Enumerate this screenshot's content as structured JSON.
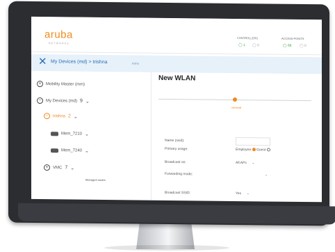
{
  "header": {
    "logo": "aruba",
    "logo_sub": "NETWORKS",
    "controllers": {
      "label": "CONTROLLERS",
      "up": "1",
      "down": "0"
    },
    "access_points": {
      "label": "ACCESS POINTS",
      "up": "66",
      "down": "0"
    }
  },
  "breadcrumb": {
    "path": "My Devices (md) > trishna",
    "tag": "trisha"
  },
  "sidebar": {
    "mobility_master": "Mobility Master (mm)",
    "my_devices": "My Devices (md)",
    "my_devices_count": "9",
    "trishna": "trishna",
    "trishna_count": "2",
    "device1": "Mem_7210",
    "device2": "Mem_7240",
    "vmc": "VMC",
    "vmc_count": "7",
    "managed_nodes": "Managed nodes"
  },
  "main": {
    "title": "New WLAN",
    "step": "General",
    "name_label": "Name (ssid):",
    "primary_label": "Primary usage:",
    "employee": "Employee",
    "guest": "Guest",
    "broadcast_on_label": "Broadcast on:",
    "broadcast_on_value": "All APs",
    "forwarding_label": "Forwarding mode:",
    "broadcast_ssid_label": "Broadcast SSID:",
    "broadcast_ssid_value": "Yes"
  }
}
